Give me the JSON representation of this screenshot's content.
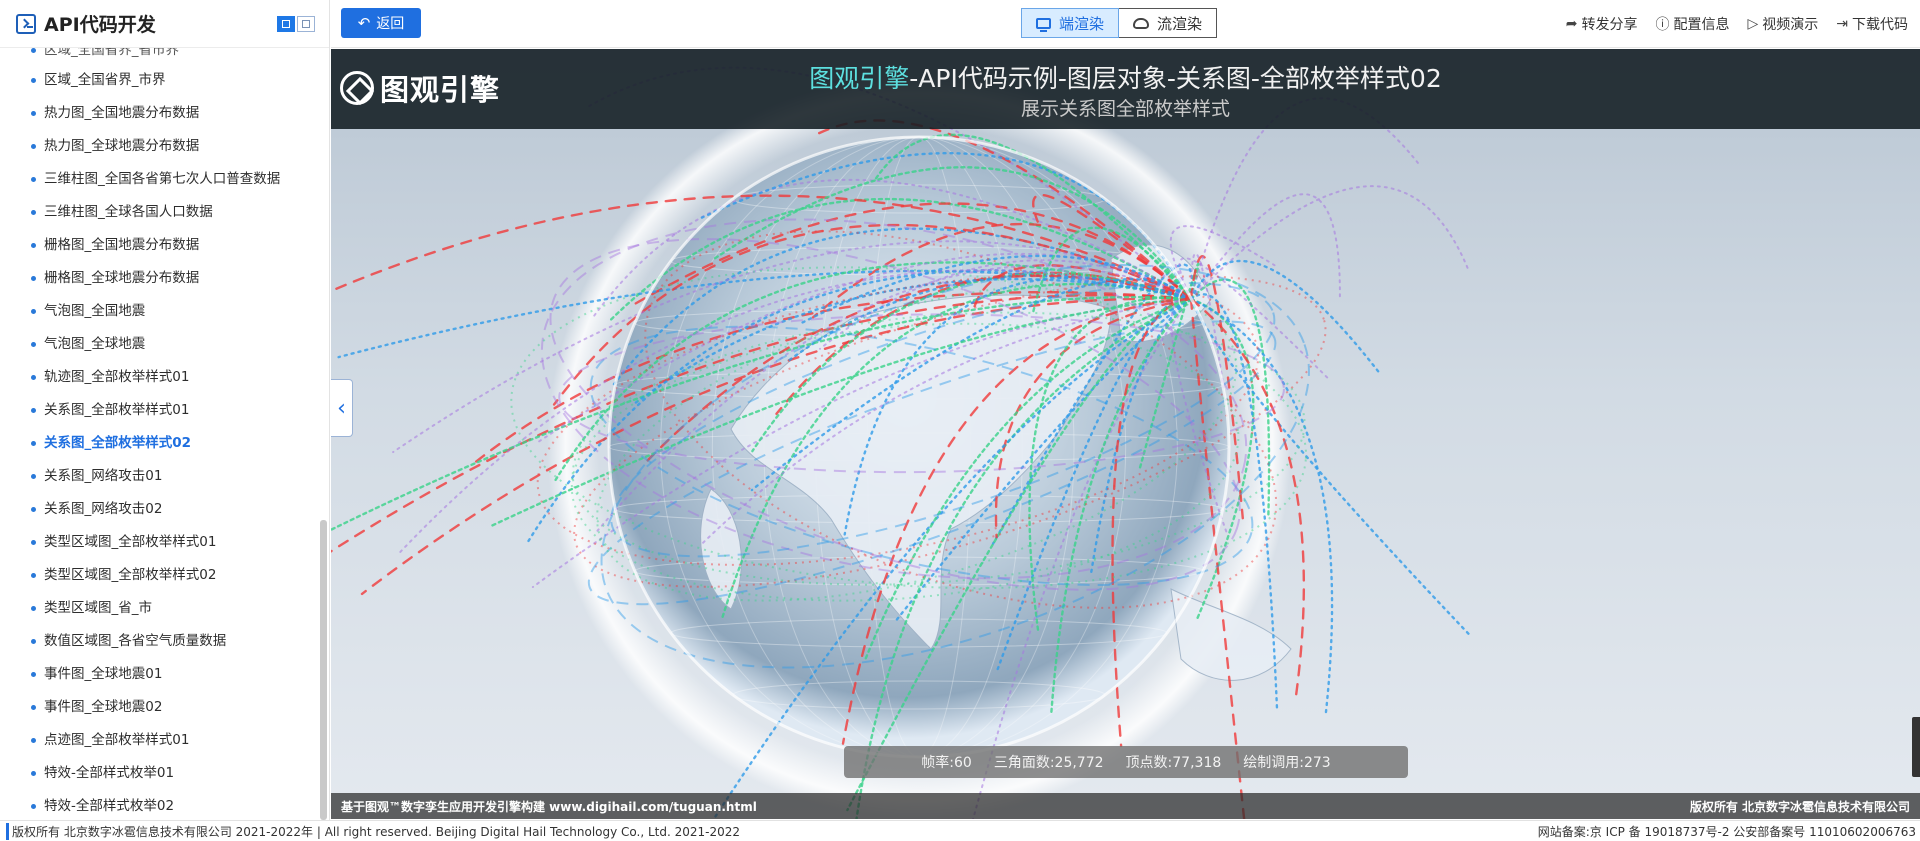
{
  "sidebar": {
    "title": "API代码开发",
    "partial_item": "区域_全国省界_省市界",
    "items": [
      "区域_全国省界_市界",
      "热力图_全国地震分布数据",
      "热力图_全球地震分布数据",
      "三维柱图_全国各省第七次人口普查数据",
      "三维柱图_全球各国人口数据",
      "栅格图_全国地震分布数据",
      "栅格图_全球地震分布数据",
      "气泡图_全国地震",
      "气泡图_全球地震",
      "轨迹图_全部枚举样式01",
      "关系图_全部枚举样式01",
      "关系图_全部枚举样式02",
      "关系图_网络攻击01",
      "关系图_网络攻击02",
      "类型区域图_全部枚举样式01",
      "类型区域图_全部枚举样式02",
      "类型区域图_省_市",
      "数值区域图_各省空气质量数据",
      "事件图_全球地震01",
      "事件图_全球地震02",
      "点迹图_全部枚举样式01",
      "特效-全部样式枚举01",
      "特效-全部样式枚举02"
    ],
    "active_item": "关系图_全部枚举样式02"
  },
  "topbar": {
    "back_label": "返回",
    "render_modes": [
      "端渲染",
      "流渲染"
    ],
    "active_mode": "端渲染",
    "actions": [
      {
        "label": "转发分享",
        "icon": "share-icon"
      },
      {
        "label": "配置信息",
        "icon": "info-icon"
      },
      {
        "label": "视频演示",
        "icon": "play-icon"
      },
      {
        "label": "下载代码",
        "icon": "download-icon"
      }
    ]
  },
  "banner": {
    "logo_text": "图观引擎",
    "title_highlight": "图观引擎",
    "title_rest": "-API代码示例-图层对象-关系图-全部枚举样式02",
    "subtitle": "展示关系图全部枚举样式"
  },
  "stats": {
    "fps_label": "帧率:",
    "fps": "60",
    "triangles_label": "三角面数:",
    "triangles": "25,772",
    "vertices_label": "顶点数:",
    "vertices": "77,318",
    "drawcalls_label": "绘制调用:",
    "drawcalls": "273"
  },
  "viewport_footer": {
    "left": "基于图观™数字孪生应用开发引擎构建 www.digihail.com/tuguan.html",
    "right": "版权所有 北京数字冰雹信息技术有限公司"
  },
  "bottombar": {
    "left": "版权所有 北京数字冰雹信息技术有限公司 2021-2022年 | All right reserved. Beijing Digital Hail Technology Co., Ltd. 2021-2022",
    "right": "网站备案:京 ICP 备 19018737号-2 公安部备案号 11010602006763"
  },
  "colors": {
    "accent": "#1f6fe0",
    "banner_highlight": "#5de0e0",
    "arc_red": "#f03a3a",
    "arc_blue": "#2f9be8",
    "arc_green": "#39d28a",
    "arc_purple": "#a676e0"
  }
}
